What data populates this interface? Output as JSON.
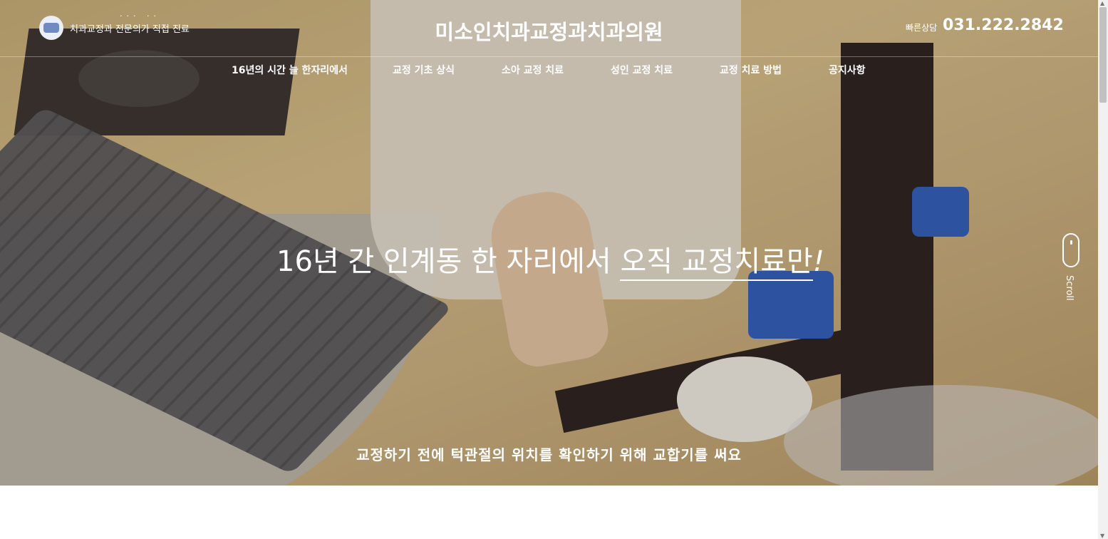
{
  "header": {
    "tagline": "치과교정과 전문의가 직접 진료",
    "tagline_dots": "··· ··",
    "site_title": "미소인치과교정과치과의원",
    "phone_label": "빠른상담",
    "phone_number": "031.222.2842"
  },
  "nav": {
    "items": [
      {
        "label": "16년의 시간 늘 한자리에서"
      },
      {
        "label": "교정 기초 상식"
      },
      {
        "label": "소아 교정 치료"
      },
      {
        "label": "성인 교정 치료"
      },
      {
        "label": "교정 치료 방법"
      },
      {
        "label": "공지사항"
      }
    ]
  },
  "hero": {
    "headline_prefix": "16년 간 인계동 한 자리에서 ",
    "headline_highlight": "오직 교정치료만",
    "headline_suffix": "!",
    "caption": "교정하기 전에 턱관절의 위치를 확인하기 위해 교합기를 써요",
    "scroll_label": "Scroll"
  },
  "icons": {
    "logo": "clinic-logo-icon",
    "scroll": "mouse-scroll-icon"
  },
  "colors": {
    "text": "#ffffff",
    "logo_accent": "#6f8bbf"
  }
}
